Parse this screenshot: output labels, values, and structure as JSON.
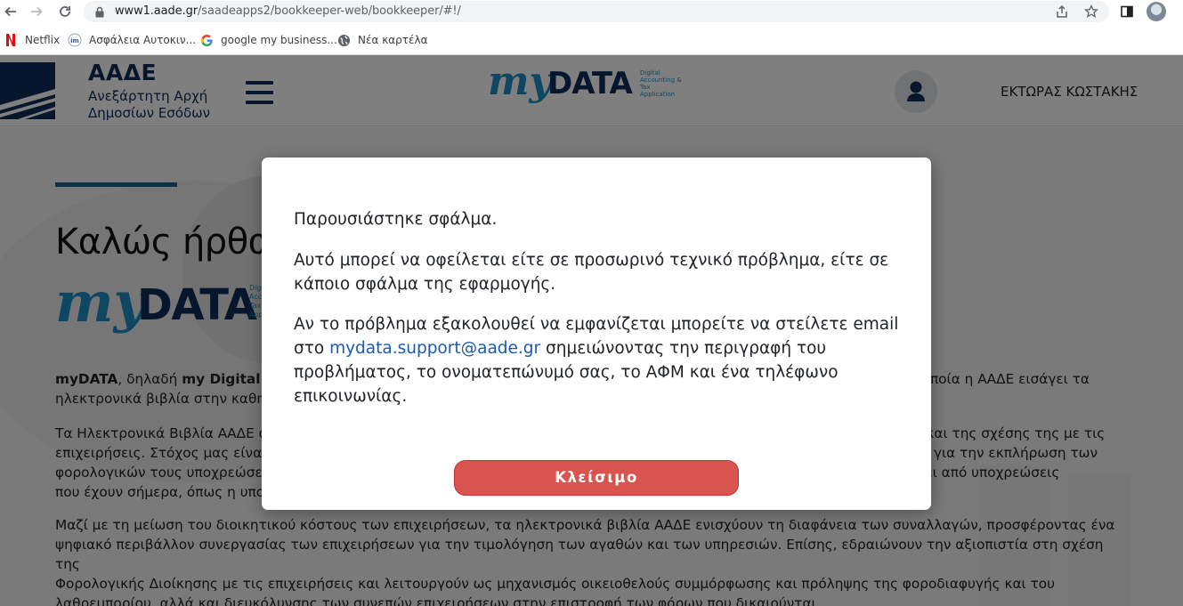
{
  "browser": {
    "url_host": "www1.aade.gr",
    "url_path": "/saadeapps2/bookkeeper-web/bookkeeper/#!/",
    "bookmarks": [
      {
        "label": "Netflix",
        "icon": "netflix-icon"
      },
      {
        "label": "Ασφάλεια Αυτοκιν...",
        "icon": "im-icon"
      },
      {
        "label": "google my business...",
        "icon": "google-icon"
      },
      {
        "label": "Νέα καρτέλα",
        "icon": "globe-icon"
      }
    ]
  },
  "header": {
    "org_short": "ΑΑΔΕ",
    "org_line1": "Ανεξάρτητη Αρχή",
    "org_line2": "Δημοσίων Εσόδων",
    "logo_my": "my",
    "logo_data": "DATA",
    "logo_tag_lines": [
      "Digital",
      "Accounting &",
      "Tax",
      "Application"
    ],
    "user_name": "ΕΚΤΩΡΑΣ ΚΩΣΤΑΚΗΣ"
  },
  "main": {
    "welcome": "Καλώς ήρθατε",
    "para1_lead": "myDATA",
    "para1_mid": ", δηλαδή ",
    "para1_bold": "my Digital Accounting and Tax Application",
    "para1_rest": ", είναι το όνομα της νέας ηλεκτρονικής πλατφόρμας με την οποία η ΑΑΔΕ εισάγει τα",
    "para1_line2": "ηλεκτρονικά βιβλία στην καθημερινότητα των επιχειρήσεων.",
    "para2_lines": [
      "Τα Ηλεκτρονικά Βιβλία ΑΑΔΕ αποτελούν μια σημαντική πρωτοβουλία ψηφιακού μετασχηματισμού της Φορολογικής Διοίκησης και της σχέσης της με τις",
      "επιχειρήσεις. Στόχος μας είναι η διευκόλυνση των επιχειρήσεων, μέσω της παροχής ενός νέου, σύγχρονου ψηφιακού εργαλείου για την εκπλήρωση των",
      "φορολογικών τους υποχρεώσεων, το οποίο θα τις απαλλάξει από υποχρεώσεις που έχουν σήμερα και σταδιακά θα τις απαλλάξει από υποχρεώσεις",
      "που έχουν σήμερα, όπως η υποβολή καταστάσεων."
    ],
    "para3_lines": [
      "Μαζί με τη μείωση του διοικητικού κόστους των επιχειρήσεων, τα ηλεκτρονικά βιβλία ΑΑΔΕ ενισχύουν τη διαφάνεια των συναλλαγών, προσφέροντας ένα",
      "ψηφιακό περιβάλλον συνεργασίας των επιχειρήσεων για την τιμολόγηση των αγαθών και των υπηρεσιών. Επίσης, εδραιώνουν την αξιοπιστία στη σχέση της",
      "Φορολογικής Διοίκησης με τις επιχειρήσεις και λειτουργούν ως μηχανισμός οικειοθελούς συμμόρφωσης και πρόληψης της φοροδιαφυγής και του",
      "λαθρεμπορίου, αλλά και διευκόλυνσης των συνεπών επιχειρήσεων στην επιστροφή των φόρων που δικαιούνται."
    ]
  },
  "modal": {
    "line1": "Παρουσιάστηκε σφάλμα.",
    "line2": "Αυτό μπορεί να οφείλεται είτε σε προσωρινό τεχνικό πρόβλημα, είτε σε κάποιο σφάλμα της εφαρμογής.",
    "line3_pre": "Αν το πρόβλημα εξακολουθεί να εμφανίζεται μπορείτε να στείλετε email στο ",
    "line3_link": "mydata.support@aade.gr",
    "line3_post": " σημειώνοντας την περιγραφή του προβλήματος, το ονοματεπώνυμό σας, το ΑΦΜ και ένα τηλέφωνο επικοινωνίας.",
    "close_label": "Κλείσιμο"
  },
  "colors": {
    "brand_navy": "#0d2d5a",
    "brand_blue": "#1e8ec6",
    "danger": "#d9534f",
    "link": "#1a5bb5"
  }
}
